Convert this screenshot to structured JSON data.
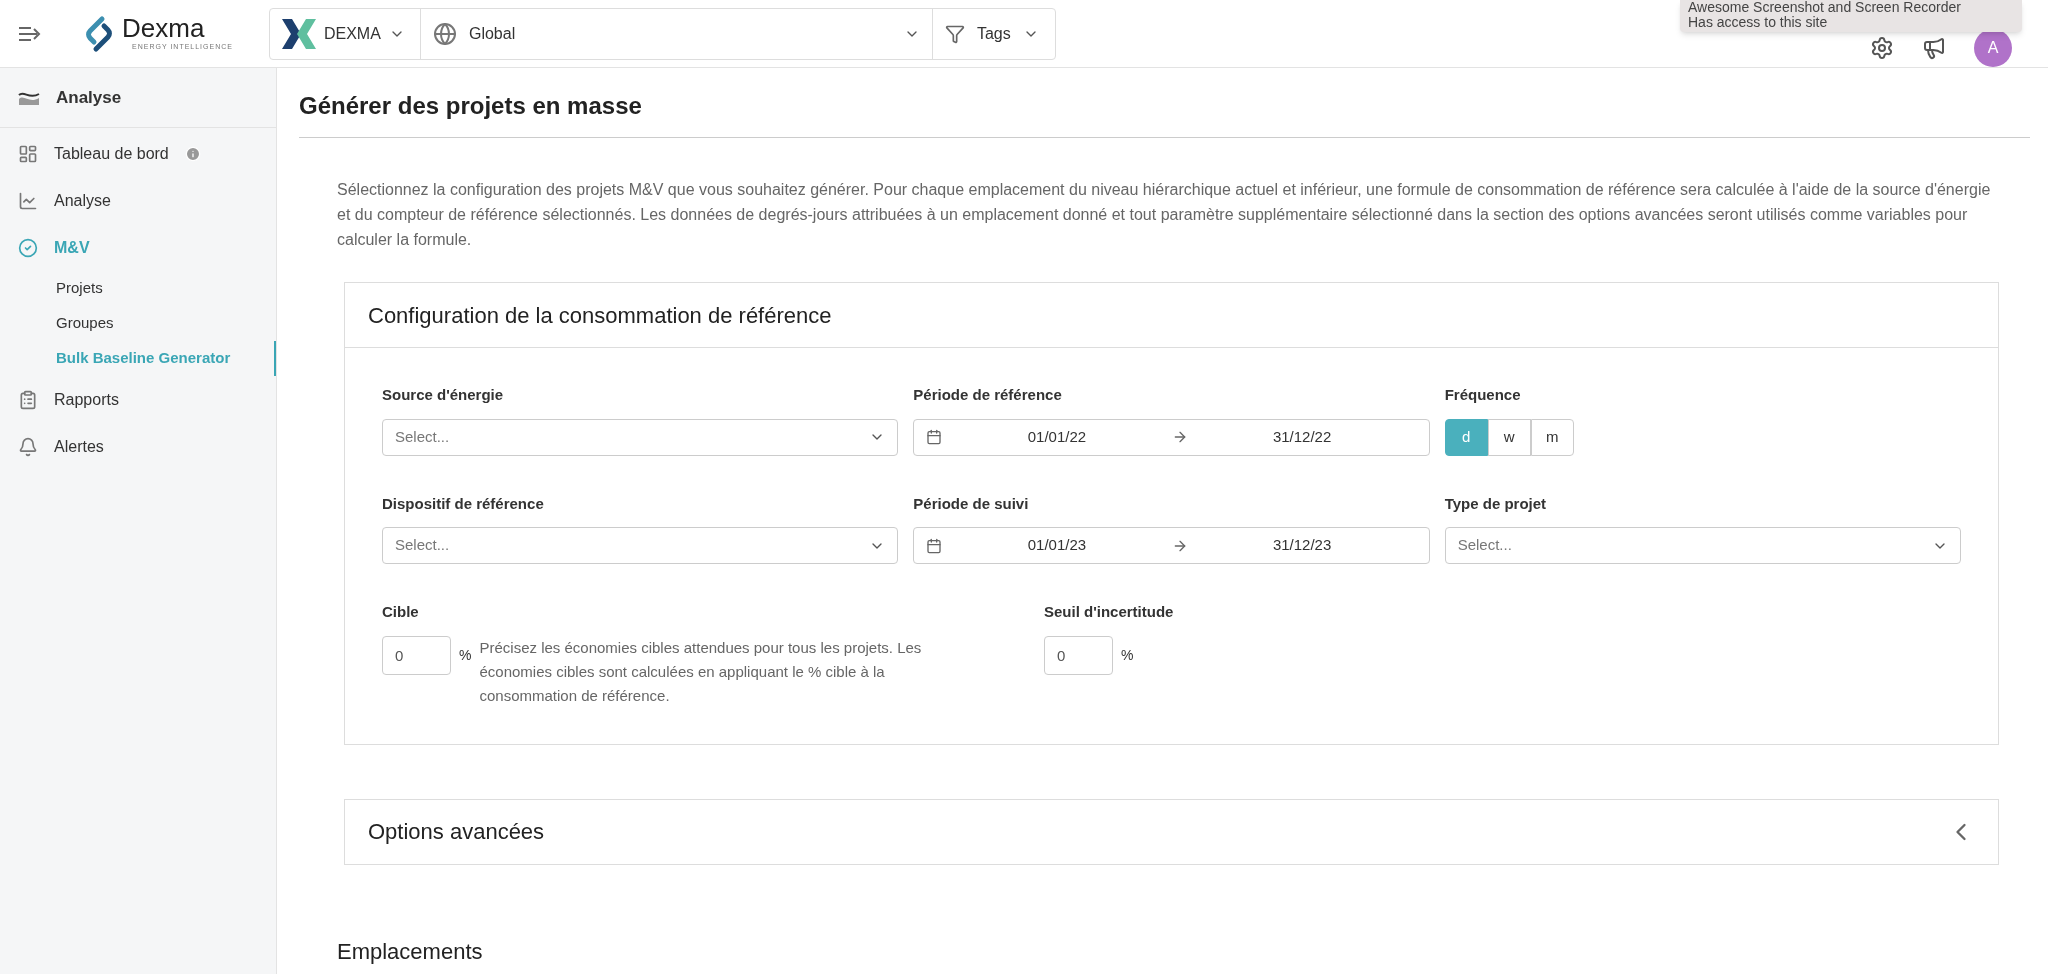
{
  "topbar": {
    "brand_name": "Dexma",
    "brand_tagline": "ENERGY INTELLIGENCE",
    "org_selector": {
      "label": "DEXMA"
    },
    "location_selector": {
      "label": "Global"
    },
    "tags_filter": {
      "label": "Tags"
    },
    "avatar": {
      "initial": "A"
    },
    "extension_popup": {
      "lines": [
        "Awesome Screenshot and Screen Recorder",
        "Has access to this site"
      ]
    }
  },
  "sidebar": {
    "section_title": "Analyse",
    "items": [
      {
        "label": "Tableau de bord",
        "kind": "dashboard",
        "selected": false,
        "info": true
      },
      {
        "label": "Analyse",
        "kind": "chart",
        "selected": false,
        "info": false
      },
      {
        "label": "M&V",
        "kind": "check",
        "selected": true,
        "info": false,
        "children": [
          {
            "label": "Projets",
            "selected": false
          },
          {
            "label": "Groupes",
            "selected": false
          },
          {
            "label": "Bulk Baseline Generator",
            "selected": true
          }
        ]
      },
      {
        "label": "Rapports",
        "kind": "report",
        "selected": false,
        "info": false
      },
      {
        "label": "Alertes",
        "kind": "alert",
        "selected": false,
        "info": false
      }
    ]
  },
  "page": {
    "title": "Générer des projets en masse",
    "description": "Sélectionnez la configuration des projets M&V que vous souhaitez générer. Pour chaque emplacement du niveau hiérarchique actuel et inférieur, une formule de consommation de référence sera calculée à l'aide de la source d'énergie et du compteur de référence sélectionnés. Les données de degrés-jours attribuées à un emplacement donné et tout paramètre supplémentaire sélectionné dans la section des options avancées seront utilisés comme variables pour calculer la formule.",
    "baseline_card": {
      "title": "Configuration de la consommation de référence",
      "energy_source": {
        "label": "Source d'énergie",
        "placeholder": "Select..."
      },
      "reference_period": {
        "label": "Période de référence",
        "start": "01/01/22",
        "end": "31/12/22"
      },
      "frequency": {
        "label": "Fréquence",
        "options": [
          {
            "label": "d",
            "selected": true
          },
          {
            "label": "w",
            "selected": false
          },
          {
            "label": "m",
            "selected": false
          }
        ]
      },
      "reference_device": {
        "label": "Dispositif de référence",
        "placeholder": "Select..."
      },
      "tracking_period": {
        "label": "Période de suivi",
        "start": "01/01/23",
        "end": "31/12/23"
      },
      "project_type": {
        "label": "Type de projet",
        "placeholder": "Select..."
      },
      "target": {
        "label": "Cible",
        "value": "0",
        "unit": "%",
        "help": "Précisez les économies cibles attendues pour tous les projets. Les économies cibles sont calculées en appliquant le % cible à la consommation de référence."
      },
      "uncertainty": {
        "label": "Seuil d'incertitude",
        "value": "0",
        "unit": "%"
      }
    },
    "advanced_options": {
      "title": "Options avancées",
      "expanded": false
    },
    "locations_title": "Emplacements"
  }
}
